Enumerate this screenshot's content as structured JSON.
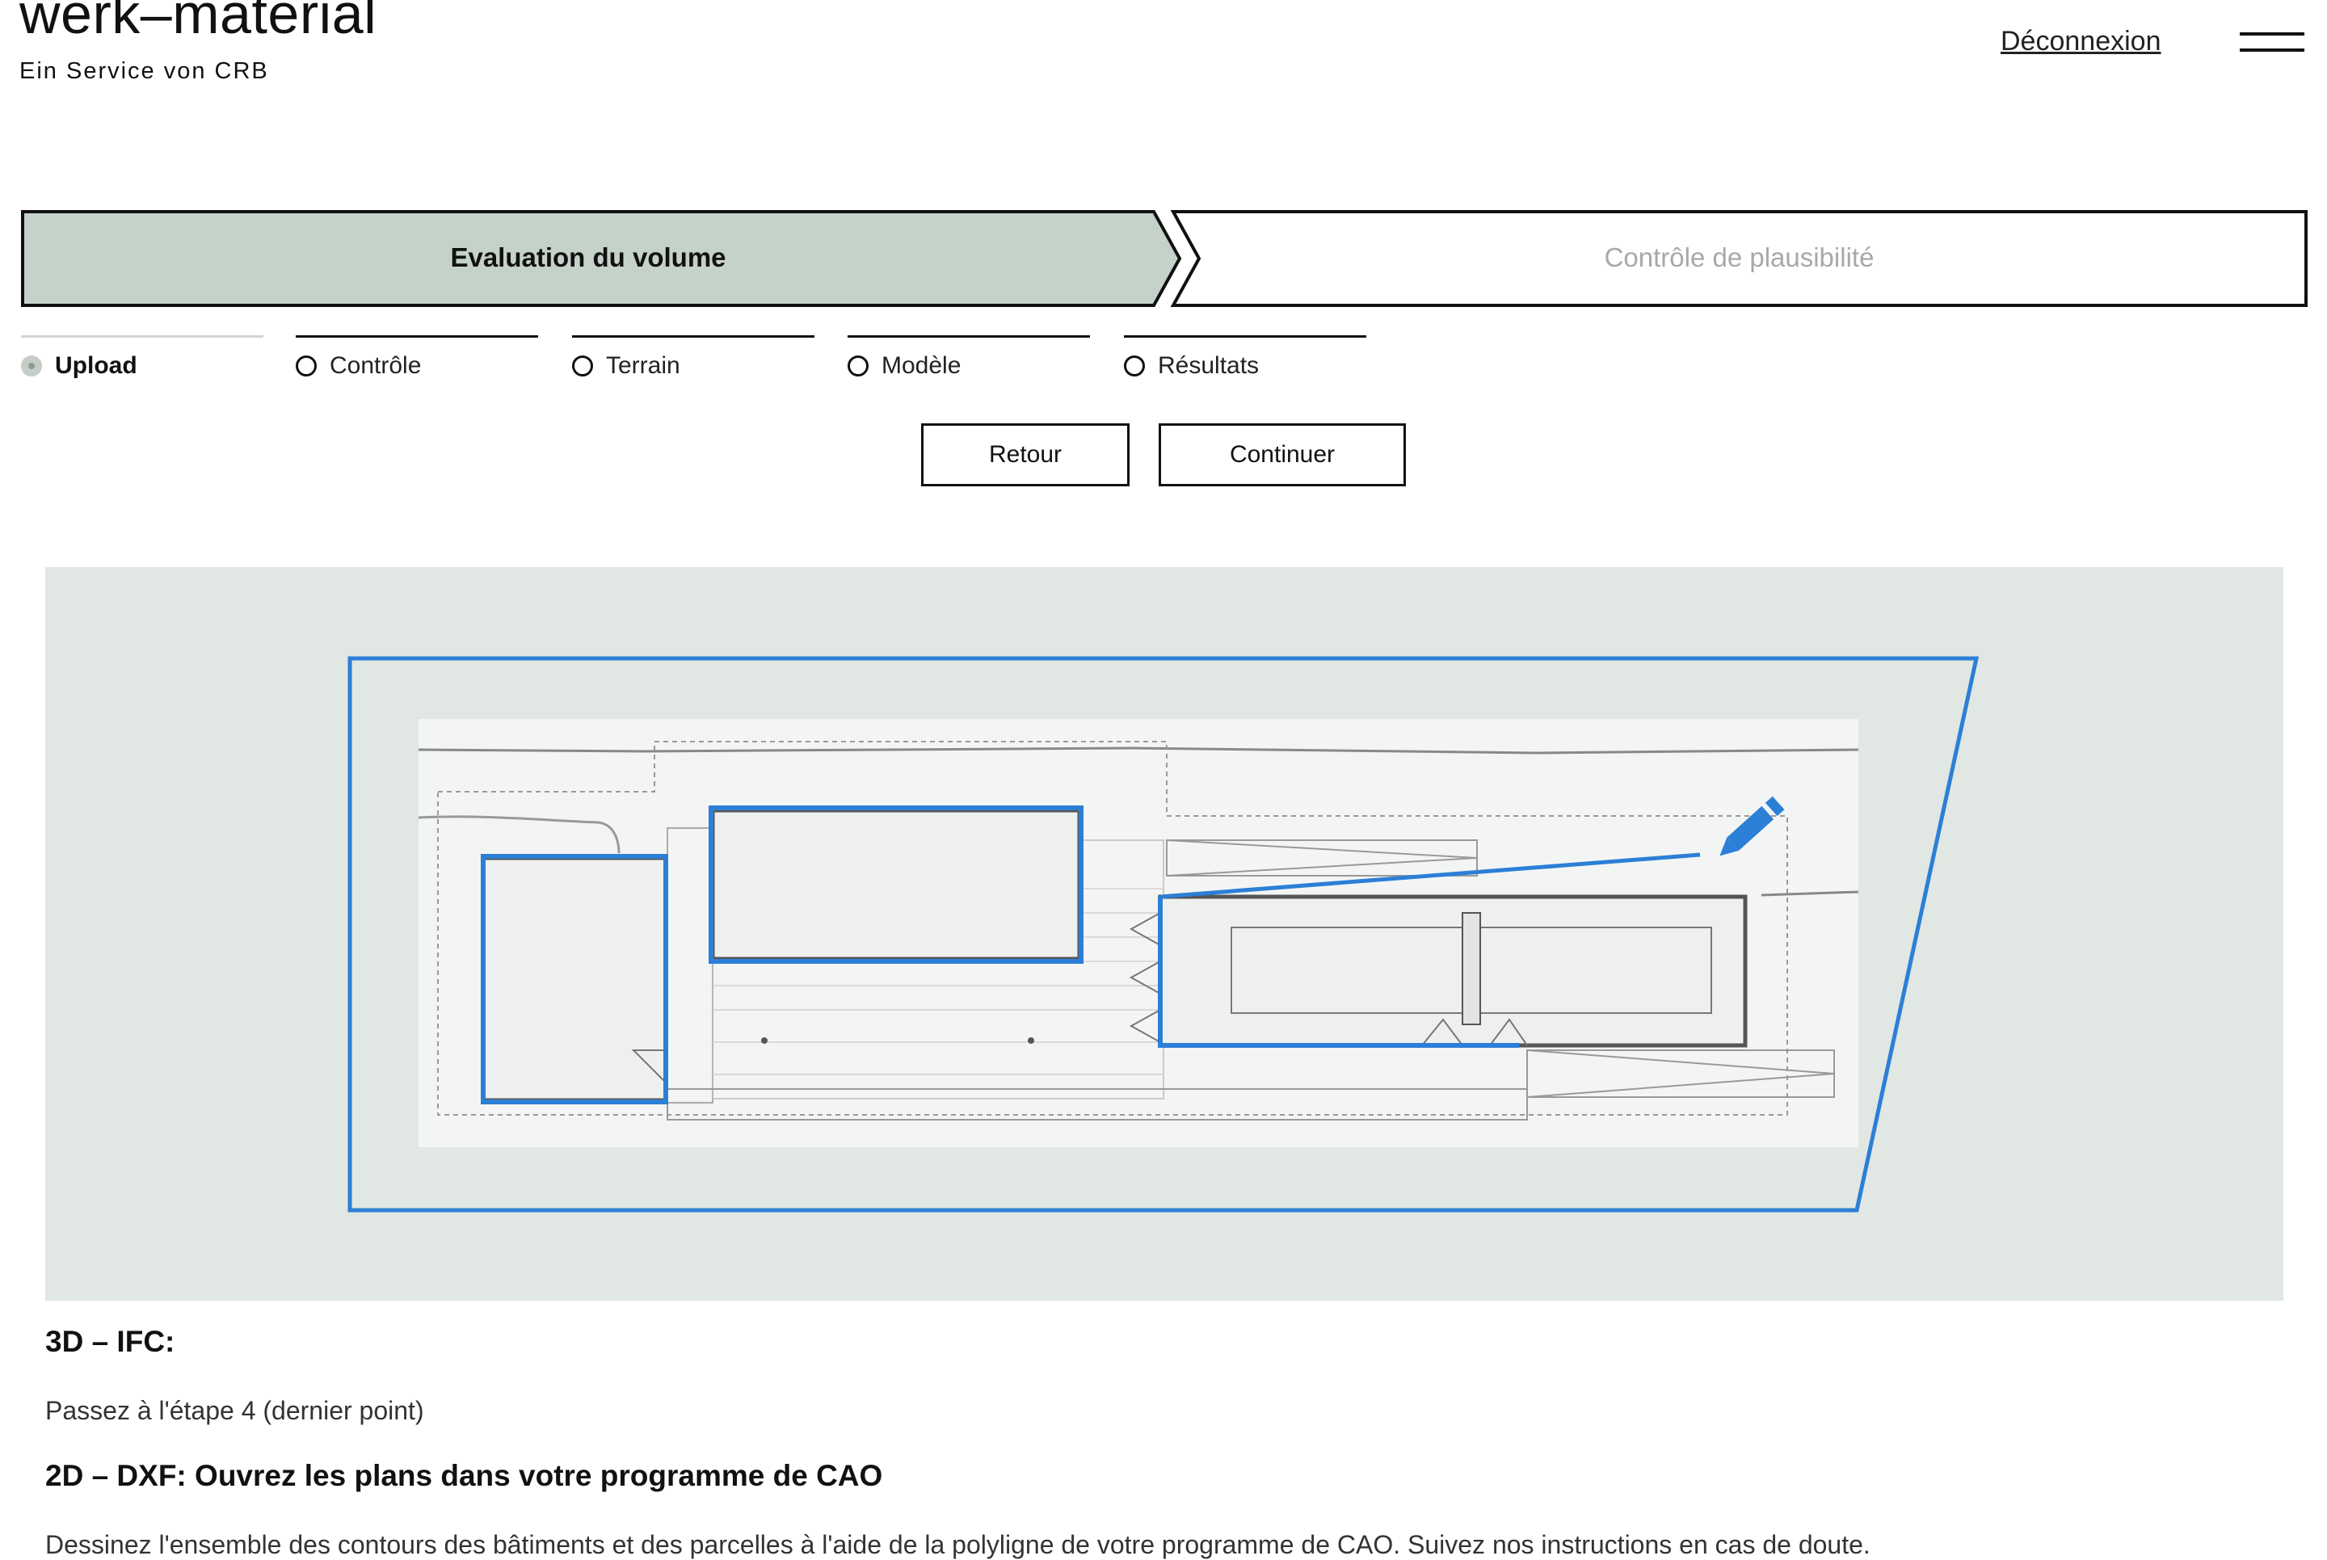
{
  "header": {
    "brand_title": "werk–material",
    "brand_subtitle": "Ein Service von CRB",
    "logout_label": "Déconnexion",
    "menu_icon": "hamburger-menu-icon"
  },
  "phases": {
    "active_label": "Evaluation du volume",
    "inactive_label": "Contrôle de plausibilité",
    "active_color": "#c5d2c9"
  },
  "steps": [
    {
      "label": "Upload",
      "state": "current"
    },
    {
      "label": "Contrôle",
      "state": "pending"
    },
    {
      "label": "Terrain",
      "state": "pending"
    },
    {
      "label": "Modèle",
      "state": "pending"
    },
    {
      "label": "Résultats",
      "state": "pending"
    }
  ],
  "buttons": {
    "back_label": "Retour",
    "next_label": "Continuer"
  },
  "figure": {
    "background_color": "#e1e7e3",
    "outline_color": "#2c7fd6",
    "tool_icon": "pencil-icon"
  },
  "instructions": {
    "ifc_heading": "3D – IFC:",
    "ifc_text": "Passez à l'étape 4 (dernier point)",
    "dxf_heading": "2D – DXF: Ouvrez les plans dans votre programme de CAO",
    "dxf_text": "Dessinez l'ensemble des contours des bâtiments et des parcelles à l'aide de la polyligne de votre programme de CAO. Suivez nos instructions en cas de doute."
  }
}
